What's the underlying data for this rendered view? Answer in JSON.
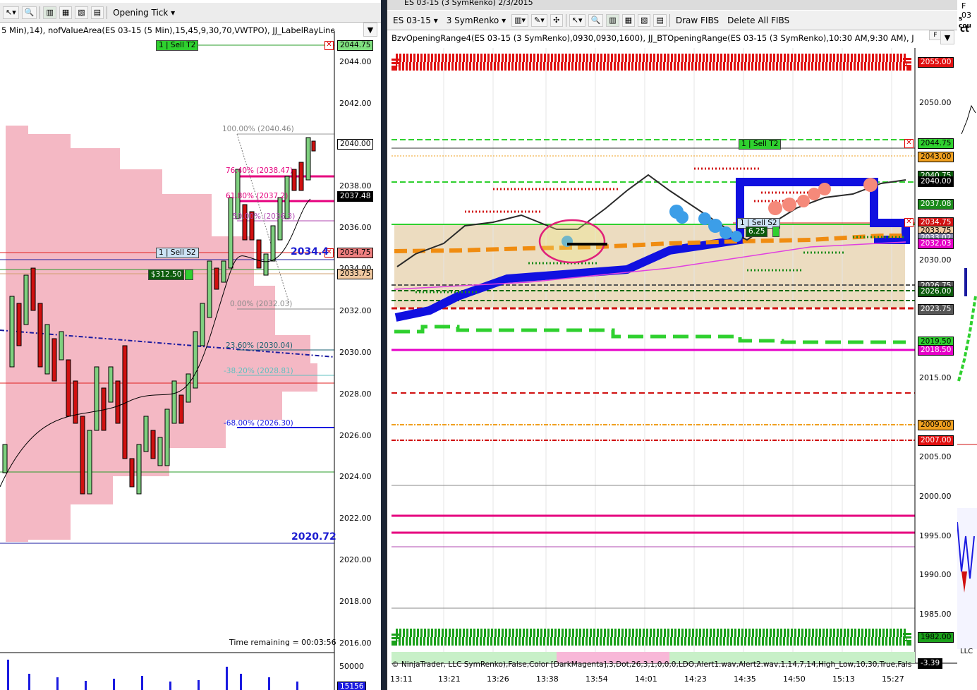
{
  "left": {
    "toolbar": {
      "tick_select": "Opening Tick"
    },
    "indicators": "5 Min),14), nofValueArea(ES 03-15 (5 Min),15,45,9,30,70,VWTPO), JJ_LabelRayLineAlerts(Alert",
    "axis_ticks": [
      "2044.00",
      "2042.00",
      "2040.00",
      "2038.00",
      "2036.00",
      "2034.00",
      "2032.00",
      "2030.00",
      "2028.00",
      "2026.00",
      "2024.00",
      "2022.00",
      "2020.00",
      "2018.00",
      "2016.00"
    ],
    "price_tags": {
      "t1": "2044.75",
      "t2": "2037.48",
      "t3": "2034.75",
      "t4": "2033.75",
      "t5": "2040.00"
    },
    "labels": {
      "sell_t2_num": "1",
      "sell_t2": "Sell T2",
      "sell_s2_num": "1",
      "sell_s2": "Sell S2",
      "pnl": "$312.50"
    },
    "fibs": {
      "f100": "100.00% (2040.46)",
      "f78": "76.40% (2038.47)",
      "f61": "61.80% (2037.2)",
      "f50": "50.00% (2036.3)",
      "f0": "0.00% (2032.03)",
      "f23": "23.60% (2030.04)",
      "f38": "-38.20% (2028.81)",
      "f68": "-68.00% (2026.30)"
    },
    "big_high": "2034.4",
    "big_low": "2020.72",
    "time_remaining": "Time remaining = 00:03:56",
    "volume_tick": "50000",
    "volume_tag": "15156"
  },
  "mid": {
    "title": "ES 03-15 (3 SymRenko)  2/3/2015",
    "toolbar": {
      "instrument": "ES 03-15",
      "bar_type": "3 SymRenko",
      "draw_fibs": "Draw FIBS",
      "delete_fibs": "Delete All FIBS"
    },
    "indicators": "BzvOpeningRange4(ES 03-15 (3 SymRenko),0930,0930,1600), JJ_BTOpeningRange(ES 03-15 (3 SymRenko),10:30 AM,9:30 AM), JJ_Fibs, DevMrktF",
    "axis_ticks": [
      "2050.00",
      "2045.00",
      "2040.00",
      "2035.00",
      "2030.00",
      "2025.00",
      "2020.00",
      "2015.00",
      "2010.00",
      "2005.00",
      "2000.00",
      "1995.00",
      "1990.00",
      "1985.00"
    ],
    "price_tags": [
      "2055.00",
      "2044.75",
      "2043.00",
      "2040.75",
      "2040.00",
      "2037.08",
      "2034.75",
      "2033.75",
      "2033.02",
      "2032.03",
      "2026.75",
      "2026.00",
      "2023.75",
      "2019.50",
      "2018.50",
      "2009.00",
      "2007.00",
      "1982.00",
      "-3.39"
    ],
    "labels": {
      "sell_t2_num": "1",
      "sell_t2": "Sell T2",
      "sell_s2_num": "1",
      "sell_s2": "Sell S2",
      "pnl": "6.25"
    },
    "footer_text": "© NinjaTrader, LLC SymRenko),False,Color [DarkMagenta],3,Dot,26,3,1,0,0,0,LDO,Alert1.wav,Alert2.wav,1,14,7,14,High_Low,10,30,True,Fals",
    "times": [
      "13:11",
      "13:21",
      "13:26",
      "13:38",
      "13:54",
      "14:01",
      "14:23",
      "14:35",
      "14:50",
      "15:13",
      "15:27"
    ]
  },
  "right": {
    "header": "F 03",
    "sub": "s cou",
    "sub2": "ct",
    "tag": "LLC"
  }
}
